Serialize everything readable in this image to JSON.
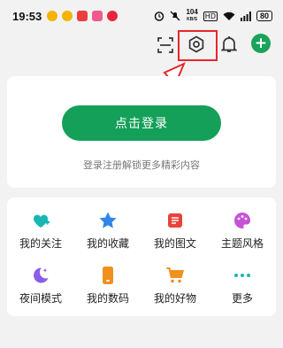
{
  "status_bar": {
    "time": "19:53",
    "network_speed_value": "104",
    "network_speed_unit": "KB/S",
    "hd_badge": "HD",
    "battery": "80"
  },
  "topbar": {
    "icons": [
      "scan-icon",
      "settings-icon",
      "bell-icon",
      "add-icon"
    ],
    "add_symbol": "+"
  },
  "login": {
    "button_label": "点击登录",
    "hint": "登录注册解锁更多精彩内容"
  },
  "menu": {
    "items": [
      {
        "label": "我的关注",
        "icon": "heart-plus-icon",
        "color": "#19b6b4"
      },
      {
        "label": "我的收藏",
        "icon": "star-icon",
        "color": "#2f86e8"
      },
      {
        "label": "我的图文",
        "icon": "document-icon",
        "color": "#e8443a"
      },
      {
        "label": "主题风格",
        "icon": "palette-icon",
        "color": "#c653d6"
      },
      {
        "label": "夜间模式",
        "icon": "moon-icon",
        "color": "#8a5ce8"
      },
      {
        "label": "我的数码",
        "icon": "phone-icon",
        "color": "#f0901f"
      },
      {
        "label": "我的好物",
        "icon": "cart-icon",
        "color": "#f0901f"
      },
      {
        "label": "更多",
        "icon": "more-icon",
        "color": "#19b6b4"
      }
    ]
  },
  "colors": {
    "accent_green": "#15a05a",
    "highlight_red": "#e8262c"
  }
}
